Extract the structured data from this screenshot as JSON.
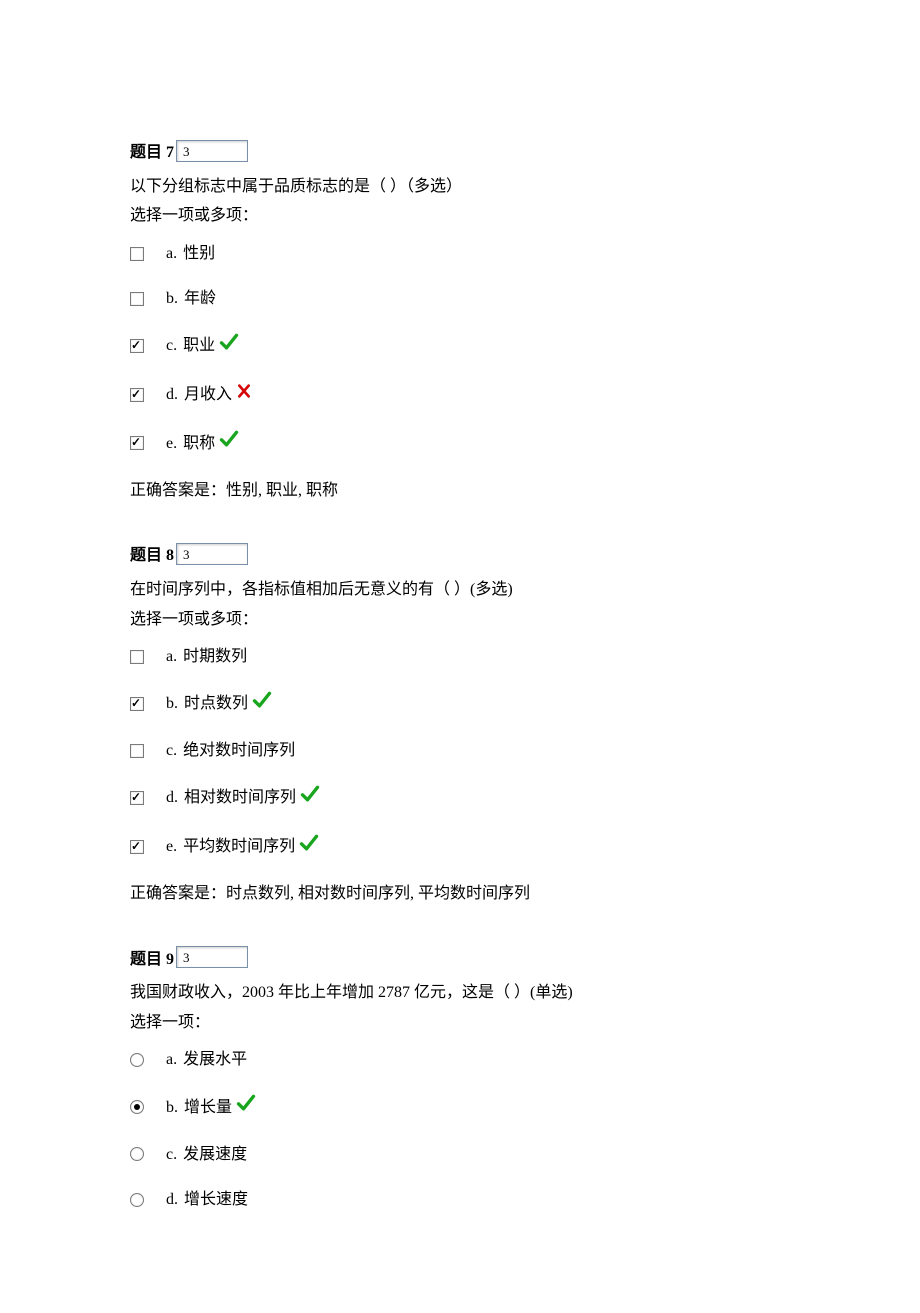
{
  "questions": [
    {
      "number": "题目 7",
      "score": "3",
      "text": "以下分组标志中属于品质标志的是（  ）（多选）",
      "instruction": "选择一项或多项：",
      "type": "checkbox",
      "options": [
        {
          "letter": "a.",
          "text": "性别",
          "checked": false,
          "mark": ""
        },
        {
          "letter": "b.",
          "text": "年龄",
          "checked": false,
          "mark": ""
        },
        {
          "letter": "c.",
          "text": "职业",
          "checked": true,
          "mark": "correct"
        },
        {
          "letter": "d.",
          "text": "月收入",
          "checked": true,
          "mark": "wrong"
        },
        {
          "letter": "e.",
          "text": "职称",
          "checked": true,
          "mark": "correct"
        }
      ],
      "correct_answer_label": "正确答案是：",
      "correct_answer": "性别, 职业, 职称"
    },
    {
      "number": "题目 8",
      "score": "3",
      "text": "在时间序列中，各指标值相加后无意义的有（  ）(多选)",
      "instruction": "选择一项或多项：",
      "type": "checkbox",
      "options": [
        {
          "letter": "a.",
          "text": "时期数列",
          "checked": false,
          "mark": ""
        },
        {
          "letter": "b.",
          "text": "时点数列",
          "checked": true,
          "mark": "correct"
        },
        {
          "letter": "c.",
          "text": "绝对数时间序列",
          "checked": false,
          "mark": ""
        },
        {
          "letter": "d.",
          "text": "相对数时间序列",
          "checked": true,
          "mark": "correct"
        },
        {
          "letter": "e.",
          "text": "平均数时间序列",
          "checked": true,
          "mark": "correct"
        }
      ],
      "correct_answer_label": "正确答案是：",
      "correct_answer": "时点数列, 相对数时间序列, 平均数时间序列"
    },
    {
      "number": "题目 9",
      "score": "3",
      "text": "我国财政收入，2003 年比上年增加 2787 亿元，这是（  ）(单选)",
      "instruction": "选择一项：",
      "type": "radio",
      "options": [
        {
          "letter": "a.",
          "text": "发展水平",
          "checked": false,
          "mark": ""
        },
        {
          "letter": "b.",
          "text": "增长量",
          "checked": true,
          "mark": "correct"
        },
        {
          "letter": "c.",
          "text": "发展速度",
          "checked": false,
          "mark": ""
        },
        {
          "letter": "d.",
          "text": "增长速度",
          "checked": false,
          "mark": ""
        }
      ],
      "correct_answer_label": "",
      "correct_answer": ""
    }
  ]
}
